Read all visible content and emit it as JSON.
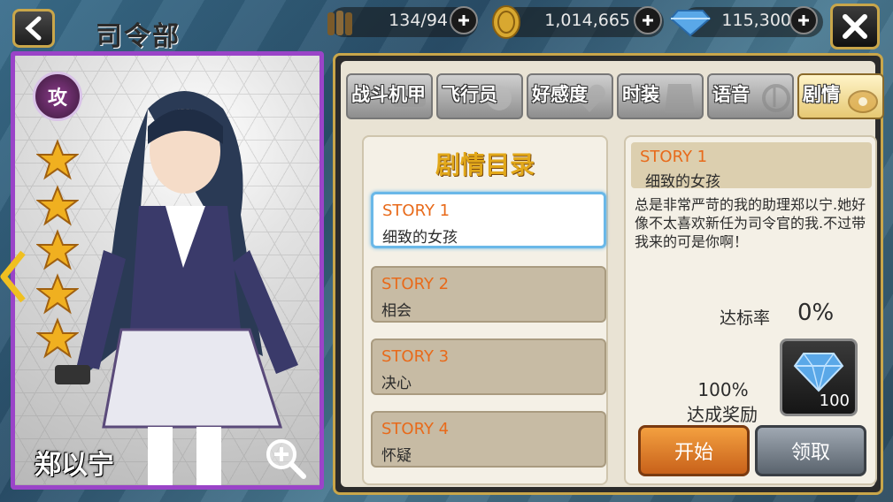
{
  "header": {
    "title": "司令部",
    "ammo": "134/94",
    "gold": "1,014,665",
    "diamonds": "115,300"
  },
  "character": {
    "role_badge": "攻",
    "stars": 5,
    "name": "郑以宁"
  },
  "tabs": [
    {
      "label": "战斗机甲",
      "active": false
    },
    {
      "label": "飞行员",
      "active": false
    },
    {
      "label": "好感度",
      "active": false
    },
    {
      "label": "时装",
      "active": false
    },
    {
      "label": "语音",
      "active": false
    },
    {
      "label": "剧情",
      "active": true
    }
  ],
  "story_list": {
    "title": "剧情目录",
    "items": [
      {
        "num": "STORY 1",
        "name": "细致的女孩",
        "selected": true
      },
      {
        "num": "STORY 2",
        "name": "相会",
        "selected": false
      },
      {
        "num": "STORY 3",
        "name": "决心",
        "selected": false
      },
      {
        "num": "STORY 4",
        "name": "怀疑",
        "selected": false
      }
    ]
  },
  "detail": {
    "num": "STORY 1",
    "name": "细致的女孩",
    "description": "总是非常严苛的我的助理郑以宁.她好像不太喜欢新任为司令官的我.不过带我来的可是你啊！",
    "rate_label": "达标率",
    "rate_value": "0%",
    "reward_pct": "100%",
    "reward_label": "达成奖励",
    "reward_count": "100",
    "start_label": "开始",
    "claim_label": "领取"
  },
  "colors": {
    "accent_gold": "#c9a64a",
    "card_border": "#9a44c8",
    "story_num": "#e86a1a",
    "list_title": "#e2a81a"
  }
}
